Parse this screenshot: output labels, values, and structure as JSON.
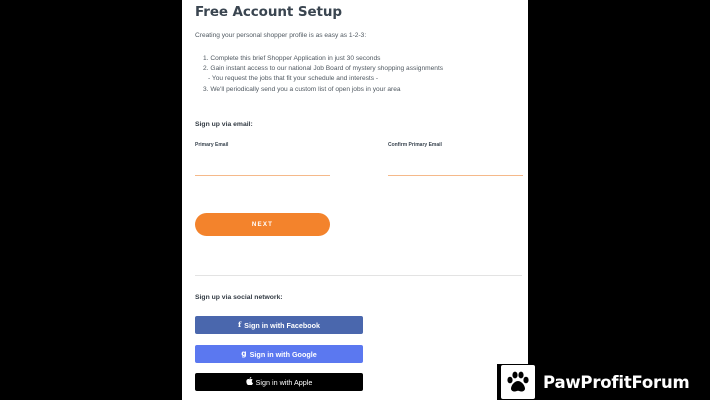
{
  "form": {
    "title": "Free Account Setup",
    "intro": "Creating your personal shopper profile is as easy as 1-2-3:",
    "steps": [
      "1. Complete this brief Shopper Application in just 30 seconds",
      "2. Gain instant access to our national Job Board of mystery shopping assignments",
      "- You request the jobs that fit your schedule and interests -",
      "3. We'll periodically send you a custom list of open jobs in your area"
    ],
    "email_heading": "Sign up via email:",
    "primary_email": {
      "label": "Primary Email",
      "value": "",
      "placeholder": ""
    },
    "confirm_email": {
      "label": "Confirm Primary Email",
      "value": "",
      "placeholder": ""
    },
    "next_label": "NEXT",
    "social_heading": "Sign up via social network:",
    "social": {
      "facebook": {
        "label": "Sign in with Facebook",
        "icon": "f-facebook-icon",
        "color": "#4a67ad"
      },
      "google": {
        "label": "Sign in with Google",
        "icon": "g-google-icon",
        "color": "#5b78f0"
      },
      "apple": {
        "label": "Sign in with Apple",
        "icon": "apple-icon",
        "color": "#000000"
      }
    }
  },
  "colors": {
    "accent": "#f3832c",
    "background": "#000000",
    "panel": "#ffffff",
    "title": "#3a4550"
  },
  "watermark": {
    "brand": "PawProfitForum",
    "icon": "paw-icon"
  }
}
